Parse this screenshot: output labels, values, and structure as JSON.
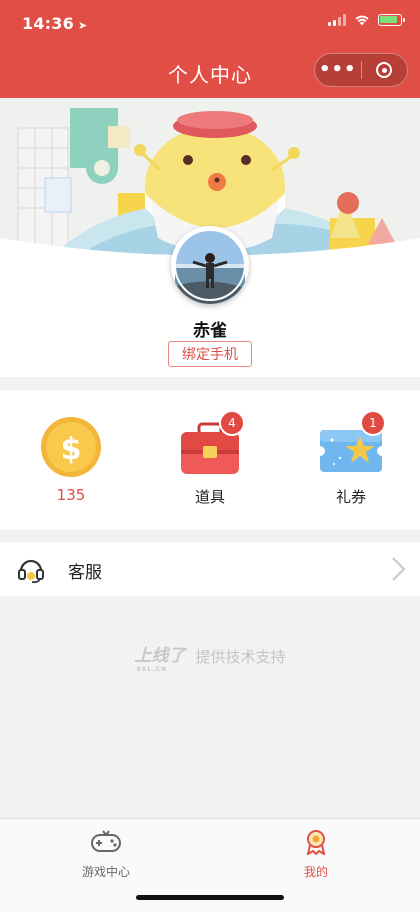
{
  "status_bar": {
    "time": "14:36"
  },
  "nav": {
    "title": "个人中心",
    "more": "•••"
  },
  "profile": {
    "name": "赤雀",
    "bind_phone": "绑定手机"
  },
  "assets": {
    "coins": {
      "value": "135",
      "color": "#e14e45"
    },
    "props": {
      "label": "道具",
      "badge": "4"
    },
    "coupons": {
      "label": "礼券",
      "badge": "1"
    }
  },
  "service": {
    "label": "客服"
  },
  "footer": {
    "logo": "上线了",
    "logo_sub": "SXL.CN",
    "support_text": "提供技术支持"
  },
  "tabbar": {
    "items": [
      {
        "label": "游戏中心",
        "active": false
      },
      {
        "label": "我的",
        "active": true
      }
    ],
    "active_color": "#e14e45"
  },
  "colors": {
    "brand": "#e14e45",
    "badge": "#e04a42"
  }
}
